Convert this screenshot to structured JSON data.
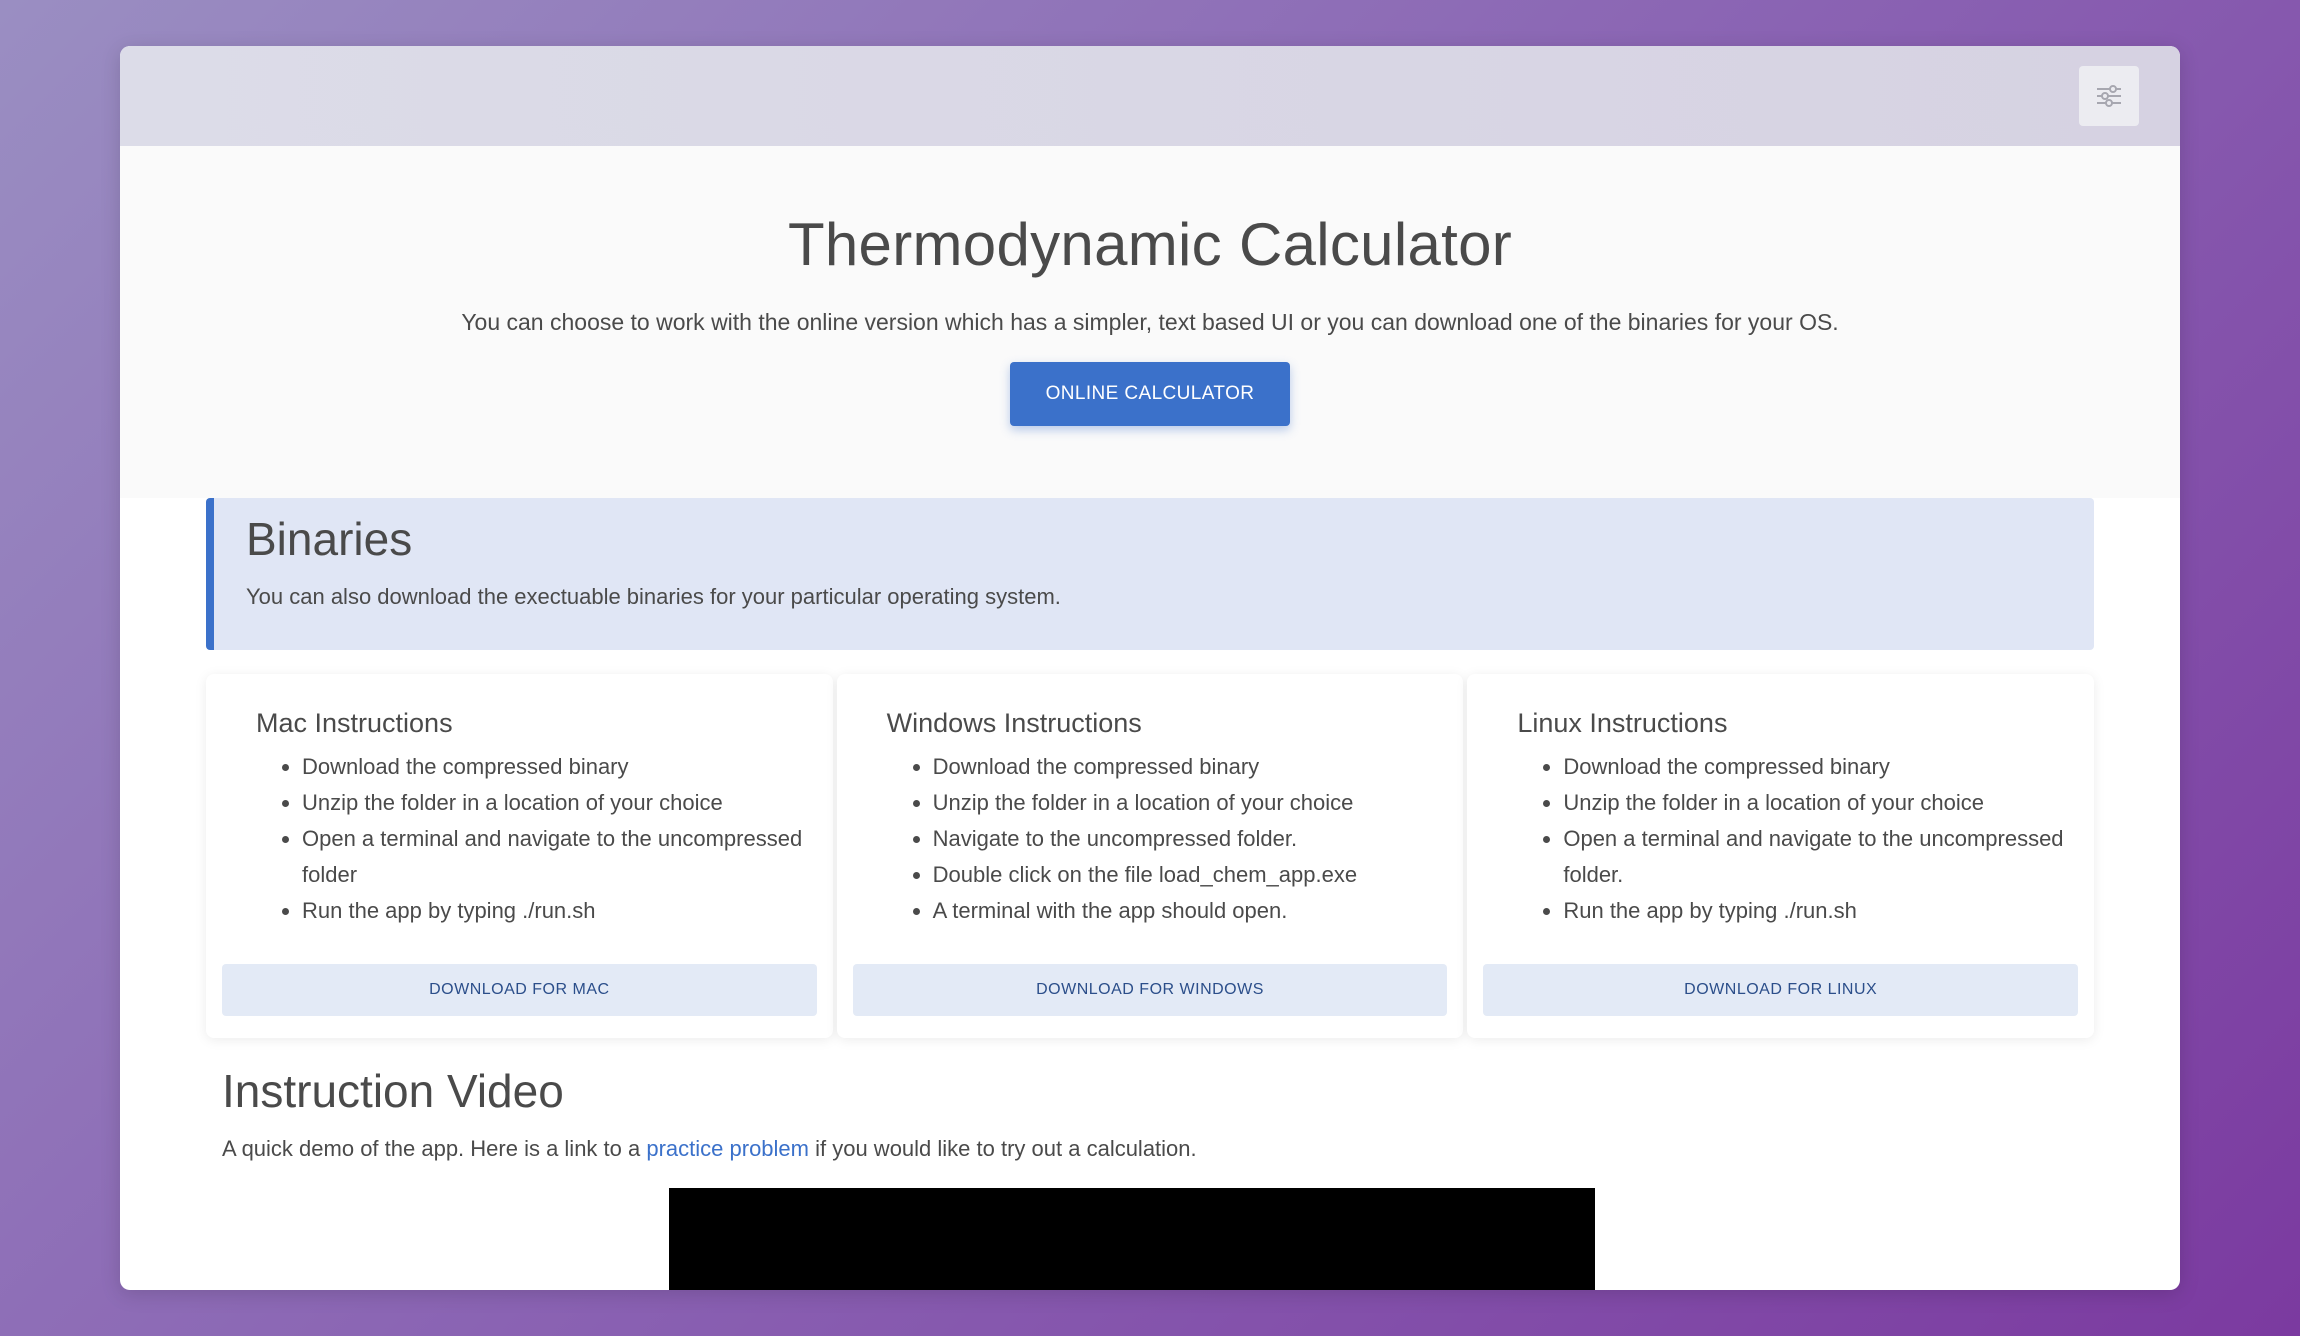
{
  "hero": {
    "title": "Thermodynamic Calculator",
    "description": "You can choose to work with the online version which has a simpler, text based UI or you can download one of the binaries for your OS.",
    "button_label": "ONLINE CALCULATOR"
  },
  "binaries": {
    "title": "Binaries",
    "description": "You can also download the exectuable binaries for your particular operating system."
  },
  "cards": [
    {
      "title": "Mac Instructions",
      "steps": [
        "Download the compressed binary",
        "Unzip the folder in a location of your choice",
        "Open a terminal and navigate to the uncompressed folder",
        "Run the app by typing ./run.sh"
      ],
      "button_label": "DOWNLOAD FOR MAC"
    },
    {
      "title": "Windows Instructions",
      "steps": [
        "Download the compressed binary",
        "Unzip the folder in a location of your choice",
        "Navigate to the uncompressed folder.",
        "Double click on the file load_chem_app.exe",
        "A terminal with the app should open."
      ],
      "button_label": "DOWNLOAD FOR WINDOWS"
    },
    {
      "title": "Linux Instructions",
      "steps": [
        "Download the compressed binary",
        "Unzip the folder in a location of your choice",
        "Open a terminal and navigate to the uncompressed folder.",
        "Run the app by typing ./run.sh"
      ],
      "button_label": "DOWNLOAD FOR LINUX"
    }
  ],
  "video_section": {
    "title": "Instruction Video",
    "text_before": "A quick demo of the app. Here is a link to a ",
    "link_text": "practice problem",
    "text_after": " if you would like to try out a calculation."
  },
  "icons": {
    "settings": "sliders-icon"
  },
  "colors": {
    "accent": "#3b71ca",
    "callout_bg": "#e0e6f5",
    "download_bg": "#e3eaf6"
  }
}
